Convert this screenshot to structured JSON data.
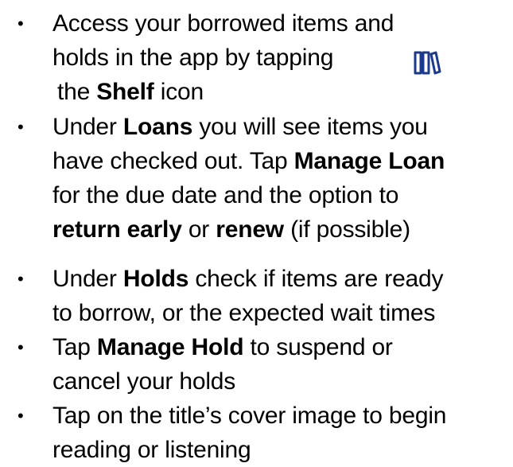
{
  "bullets": [
    {
      "lines": [
        [
          "Access your borrowed items and"
        ],
        [
          "holds in the app by tapping"
        ],
        [
          "the ",
          {
            "b": "Shelf"
          },
          " icon"
        ]
      ]
    },
    {
      "lines": [
        [
          "Under ",
          {
            "b": "Loans"
          },
          " you will see items you"
        ],
        [
          "have checked out. Tap ",
          {
            "b": "Manage Loan"
          }
        ],
        [
          "for the due date and the option to"
        ],
        [
          {
            "b": "return early"
          },
          " or ",
          {
            "b": "renew"
          },
          " (if possible)"
        ]
      ]
    },
    {
      "lines": [
        [
          "Under ",
          {
            "b": "Holds"
          },
          " check if items are ready"
        ],
        [
          "to borrow, or the expected wait times"
        ]
      ]
    },
    {
      "lines": [
        [
          "Tap ",
          {
            "b": "Manage Hold"
          },
          " to suspend or"
        ],
        [
          "cancel your holds"
        ]
      ]
    },
    {
      "lines": [
        [
          "Tap on the title’s cover image to begin"
        ],
        [
          "reading or listening"
        ]
      ]
    }
  ],
  "bullet_glyph": "•",
  "icons": {
    "shelf_icon": "shelf-icon",
    "color": "#1b3a8c"
  }
}
